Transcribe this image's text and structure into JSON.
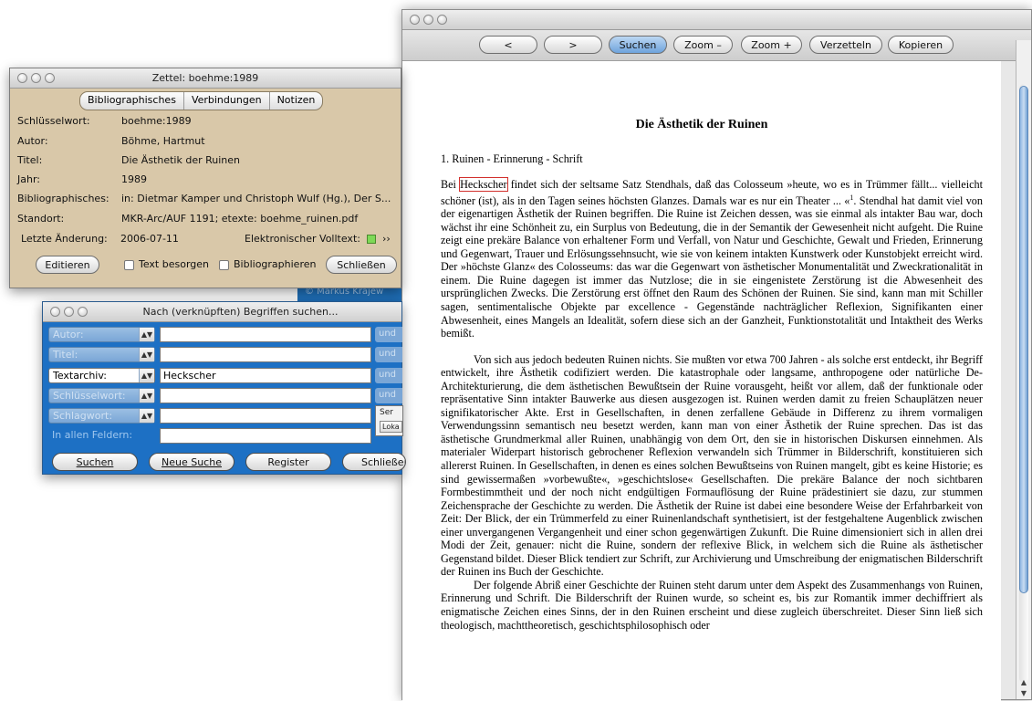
{
  "doc": {
    "toolbar": {
      "back": "<",
      "forward": ">",
      "search": "Suchen",
      "zoom_out": "Zoom –",
      "zoom_in": "Zoom +",
      "card": "Verzetteln",
      "copy": "Kopieren"
    },
    "title": "Die Ästhetik der Ruinen",
    "section": "1. Ruinen - Erinnerung - Schrift",
    "p1_pre": "Bei ",
    "p1_hl": "Heckscher",
    "p1_a": " findet sich der seltsame Satz Stendhals, daß das Colosseum »heute, wo es in Trümmer fällt... vielleicht schöner (ist), als in den Tagen seines höchsten Glanzes. Damals war es nur ein Theater ... «",
    "p1_sup": "1",
    "p1_b": ". Stendhal hat damit viel von der eigenartigen Ästhetik der Ruinen begriffen. Die Ruine ist Zeichen dessen, was sie einmal als intakter Bau war, doch wächst ihr eine Schönheit zu, ein Surplus von Bedeutung, die in der Semantik der Gewesenheit nicht aufgeht. Die Ruine zeigt eine prekäre Balance von erhaltener Form und Verfall, von Natur und Geschichte, Gewalt und Frieden, Erinnerung und Gegenwart, Trauer und Erlösungssehnsucht, wie sie von keinem intakten Kunstwerk oder Kunstobjekt erreicht wird. Der »höchste Glanz« des Colosseums: das war die Gegenwart von ästhetischer Monumentalität und Zweckrationalität in einem. Die Ruine dagegen ist immer das Nutzlose; die in sie eingenistete Zerstörung ist die Abwesenheit des ursprünglichen Zwecks. Die Zerstörung erst öffnet den Raum des Schönen der Ruinen. Sie sind, kann man mit Schiller sagen, sentimentalische Objekte par excellence - Gegenstände nachträglicher Reflexion, Signifikanten einer Abwesenheit, eines Mangels an Idealität, sofern diese sich an der Ganzheit, Funktionstotalität und Intaktheit des Werks bemißt.",
    "p2": "Von sich aus jedoch bedeuten Ruinen nichts. Sie mußten vor etwa 700 Jahren - als solche erst entdeckt, ihr Begriff entwickelt, ihre Ästhetik codifiziert werden. Die katastrophale oder langsame, anthropogene oder natürliche De-Architekturierung, die dem ästhetischen Bewußtsein der Ruine vorausgeht, heißt vor allem, daß der funktionale oder repräsentative Sinn intakter Bauwerke aus diesen ausgezogen ist. Ruinen werden damit zu freien Schauplätzen neuer signifikatorischer Akte. Erst in Gesellschaften, in denen zerfallene Gebäude in Differenz zu ihrem vormaligen Verwendungssinn semantisch neu besetzt werden, kann man von einer Ästhetik der Ruine sprechen. Das ist das ästhetische Grundmerkmal aller Ruinen, unabhängig von dem Ort, den sie in historischen Diskursen einnehmen. Als materialer Widerpart historisch gebrochener Reflexion verwandeln sich Trümmer in Bilderschrift, konstituieren sich allererst Ruinen. In Gesellschaften, in denen es eines solchen Bewußtseins von Ruinen mangelt, gibt es keine Historie; es sind gewissermaßen »vorbewußte«, »geschichtslose« Gesellschaften. Die prekäre Balance der noch sichtbaren Formbestimmtheit und der noch nicht endgültigen Formauflösung der Ruine prädestiniert sie dazu, zur stummen Zeichensprache der Geschichte zu werden. Die Ästhetik der Ruine ist dabei eine besondere Weise der Erfahrbarkeit von Zeit: Der Blick, der ein Trümmerfeld zu einer Ruinenlandschaft synthetisiert, ist der festgehaltene Augenblick zwischen einer unvergangenen Vergangenheit und einer schon gegenwärtigen Zukunft. Die Ruine dimensioniert sich in allen drei Modi der Zeit, genauer: nicht die Ruine, sondern der reflexive Blick, in welchem sich die Ruine als ästhetischer Gegenstand bildet. Dieser Blick tendiert zur Schrift, zur Archivierung und Umschreibung der enigmatischen Bilderschrift der Ruinen ins Buch der Geschichte.",
    "p3": "Der folgende Abriß einer Geschichte der Ruinen steht darum unter dem Aspekt des Zusammenhangs von Ruinen, Erinnerung und Schrift. Die Bilderschrift der Ruinen wurde, so scheint es, bis zur Romantik immer dechiffriert als enigmatische Zeichen eines Sinns, der in den Ruinen erscheint und diese zugleich überschreitet. Dieser Sinn ließ sich theologisch, machttheoretisch, geschichtsphilosophisch oder"
  },
  "zettel": {
    "title": "Zettel: boehme:1989",
    "tabs": [
      "Bibliographisches",
      "Verbindungen",
      "Notizen"
    ],
    "fields": [
      {
        "label": "Schlüsselwort:",
        "value": "boehme:1989"
      },
      {
        "label": "Autor:",
        "value": "Böhme, Hartmut"
      },
      {
        "label": "Titel:",
        "value": "Die Ästhetik der Ruinen"
      },
      {
        "label": "Jahr:",
        "value": "1989"
      },
      {
        "label": "Bibliographisches:",
        "value": "in: Dietmar Kamper und Christoph Wulf (Hg.), Der S..."
      },
      {
        "label": "Standort:",
        "value": "MKR-Arc/AUF  1191; etexte: boehme_ruinen.pdf"
      }
    ],
    "changed_label": "Letzte Änderung:",
    "changed_value": "2006-07-11",
    "fulltext_label": "Elektronischer Volltext:",
    "fulltext_arrow": "››",
    "edit_btn": "Editieren",
    "chk_text": "Text besorgen",
    "chk_biblio": "Bibliographieren",
    "close_btn": "Schließen"
  },
  "strip_text": "© Markus Krajew",
  "search": {
    "title": "Nach (verknüpften) Begriffen suchen...",
    "rows": [
      {
        "field": "Autor:",
        "value": "",
        "op": "und"
      },
      {
        "field": "Titel:",
        "value": "",
        "op": "und"
      },
      {
        "field": "Textarchiv:",
        "value": "Heckscher",
        "op": "und"
      },
      {
        "field": "Schlüsselwort:",
        "value": "",
        "op": "und"
      },
      {
        "field": "Schlagwort:",
        "value": ""
      }
    ],
    "all_label": "In allen Feldern:",
    "side_label": "Ser",
    "side_btn": "Loka",
    "buttons": {
      "search": "Suchen",
      "new": "Neue Suche",
      "register": "Register",
      "close": "Schließen"
    }
  }
}
